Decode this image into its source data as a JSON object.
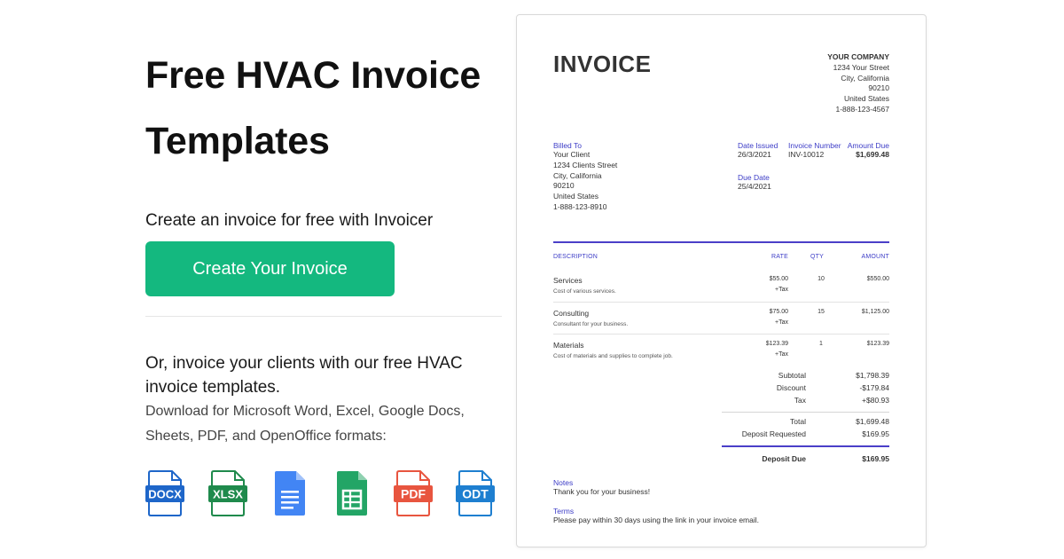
{
  "hero": {
    "title_line1": "Free HVAC Invoice",
    "title_line2": "Templates",
    "cta_text": "Create an invoice for free with Invoicer",
    "cta_button": "Create Your Invoice",
    "alt_heading": "Or, invoice your clients with our free HVAC invoice templates.",
    "alt_sub": "Download for Microsoft Word, Excel, Google Docs, Sheets, PDF, and OpenOffice formats:"
  },
  "formats": [
    {
      "label": "DOCX",
      "icon": "docx-file-icon",
      "color": "#1e66c9"
    },
    {
      "label": "XLSX",
      "icon": "xlsx-file-icon",
      "color": "#1f8a4c"
    },
    {
      "label": "",
      "icon": "google-docs-icon",
      "color": "#4285f4"
    },
    {
      "label": "",
      "icon": "google-sheets-icon",
      "color": "#23a566"
    },
    {
      "label": "PDF",
      "icon": "pdf-file-icon",
      "color": "#e8553f"
    },
    {
      "label": "ODT",
      "icon": "odt-file-icon",
      "color": "#1e7fd0"
    }
  ],
  "invoice": {
    "title": "INVOICE",
    "company": {
      "name": "YOUR COMPANY",
      "street": "1234 Your Street",
      "city": "City, California",
      "zip": "90210",
      "country": "United States",
      "phone": "1-888-123-4567"
    },
    "billed_to": {
      "label": "Billed To",
      "name": "Your Client",
      "street": "1234 Clients Street",
      "city": "City, California",
      "zip": "90210",
      "country": "United States",
      "phone": "1-888-123-8910"
    },
    "date_issued": {
      "label": "Date Issued",
      "value": "26/3/2021"
    },
    "due_date": {
      "label": "Due Date",
      "value": "25/4/2021"
    },
    "invoice_number": {
      "label": "Invoice Number",
      "value": "INV-10012"
    },
    "amount_due": {
      "label": "Amount Due",
      "value": "$1,699.48"
    },
    "columns": {
      "description": "DESCRIPTION",
      "rate": "RATE",
      "qty": "QTY",
      "amount": "AMOUNT"
    },
    "items": [
      {
        "desc": "Services",
        "note": "Cost of various services.",
        "rate": "$55.00",
        "tax": "+Tax",
        "qty": "10",
        "amount": "$550.00"
      },
      {
        "desc": "Consulting",
        "note": "Consultant for your business.",
        "rate": "$75.00",
        "tax": "+Tax",
        "qty": "15",
        "amount": "$1,125.00"
      },
      {
        "desc": "Materials",
        "note": "Cost of materials and supplies to complete job.",
        "rate": "$123.39",
        "tax": "+Tax",
        "qty": "1",
        "amount": "$123.39"
      }
    ],
    "totals": {
      "subtotal_label": "Subtotal",
      "subtotal": "$1,798.39",
      "discount_label": "Discount",
      "discount": "-$179.84",
      "tax_label": "Tax",
      "tax": "+$80.93",
      "total_label": "Total",
      "total": "$1,699.48",
      "deposit_requested_label": "Deposit Requested",
      "deposit_requested": "$169.95",
      "deposit_due_label": "Deposit Due",
      "deposit_due": "$169.95"
    },
    "notes": {
      "label": "Notes",
      "text": "Thank you for your business!"
    },
    "terms": {
      "label": "Terms",
      "text": "Please pay within 30 days using the link in your invoice email."
    }
  }
}
